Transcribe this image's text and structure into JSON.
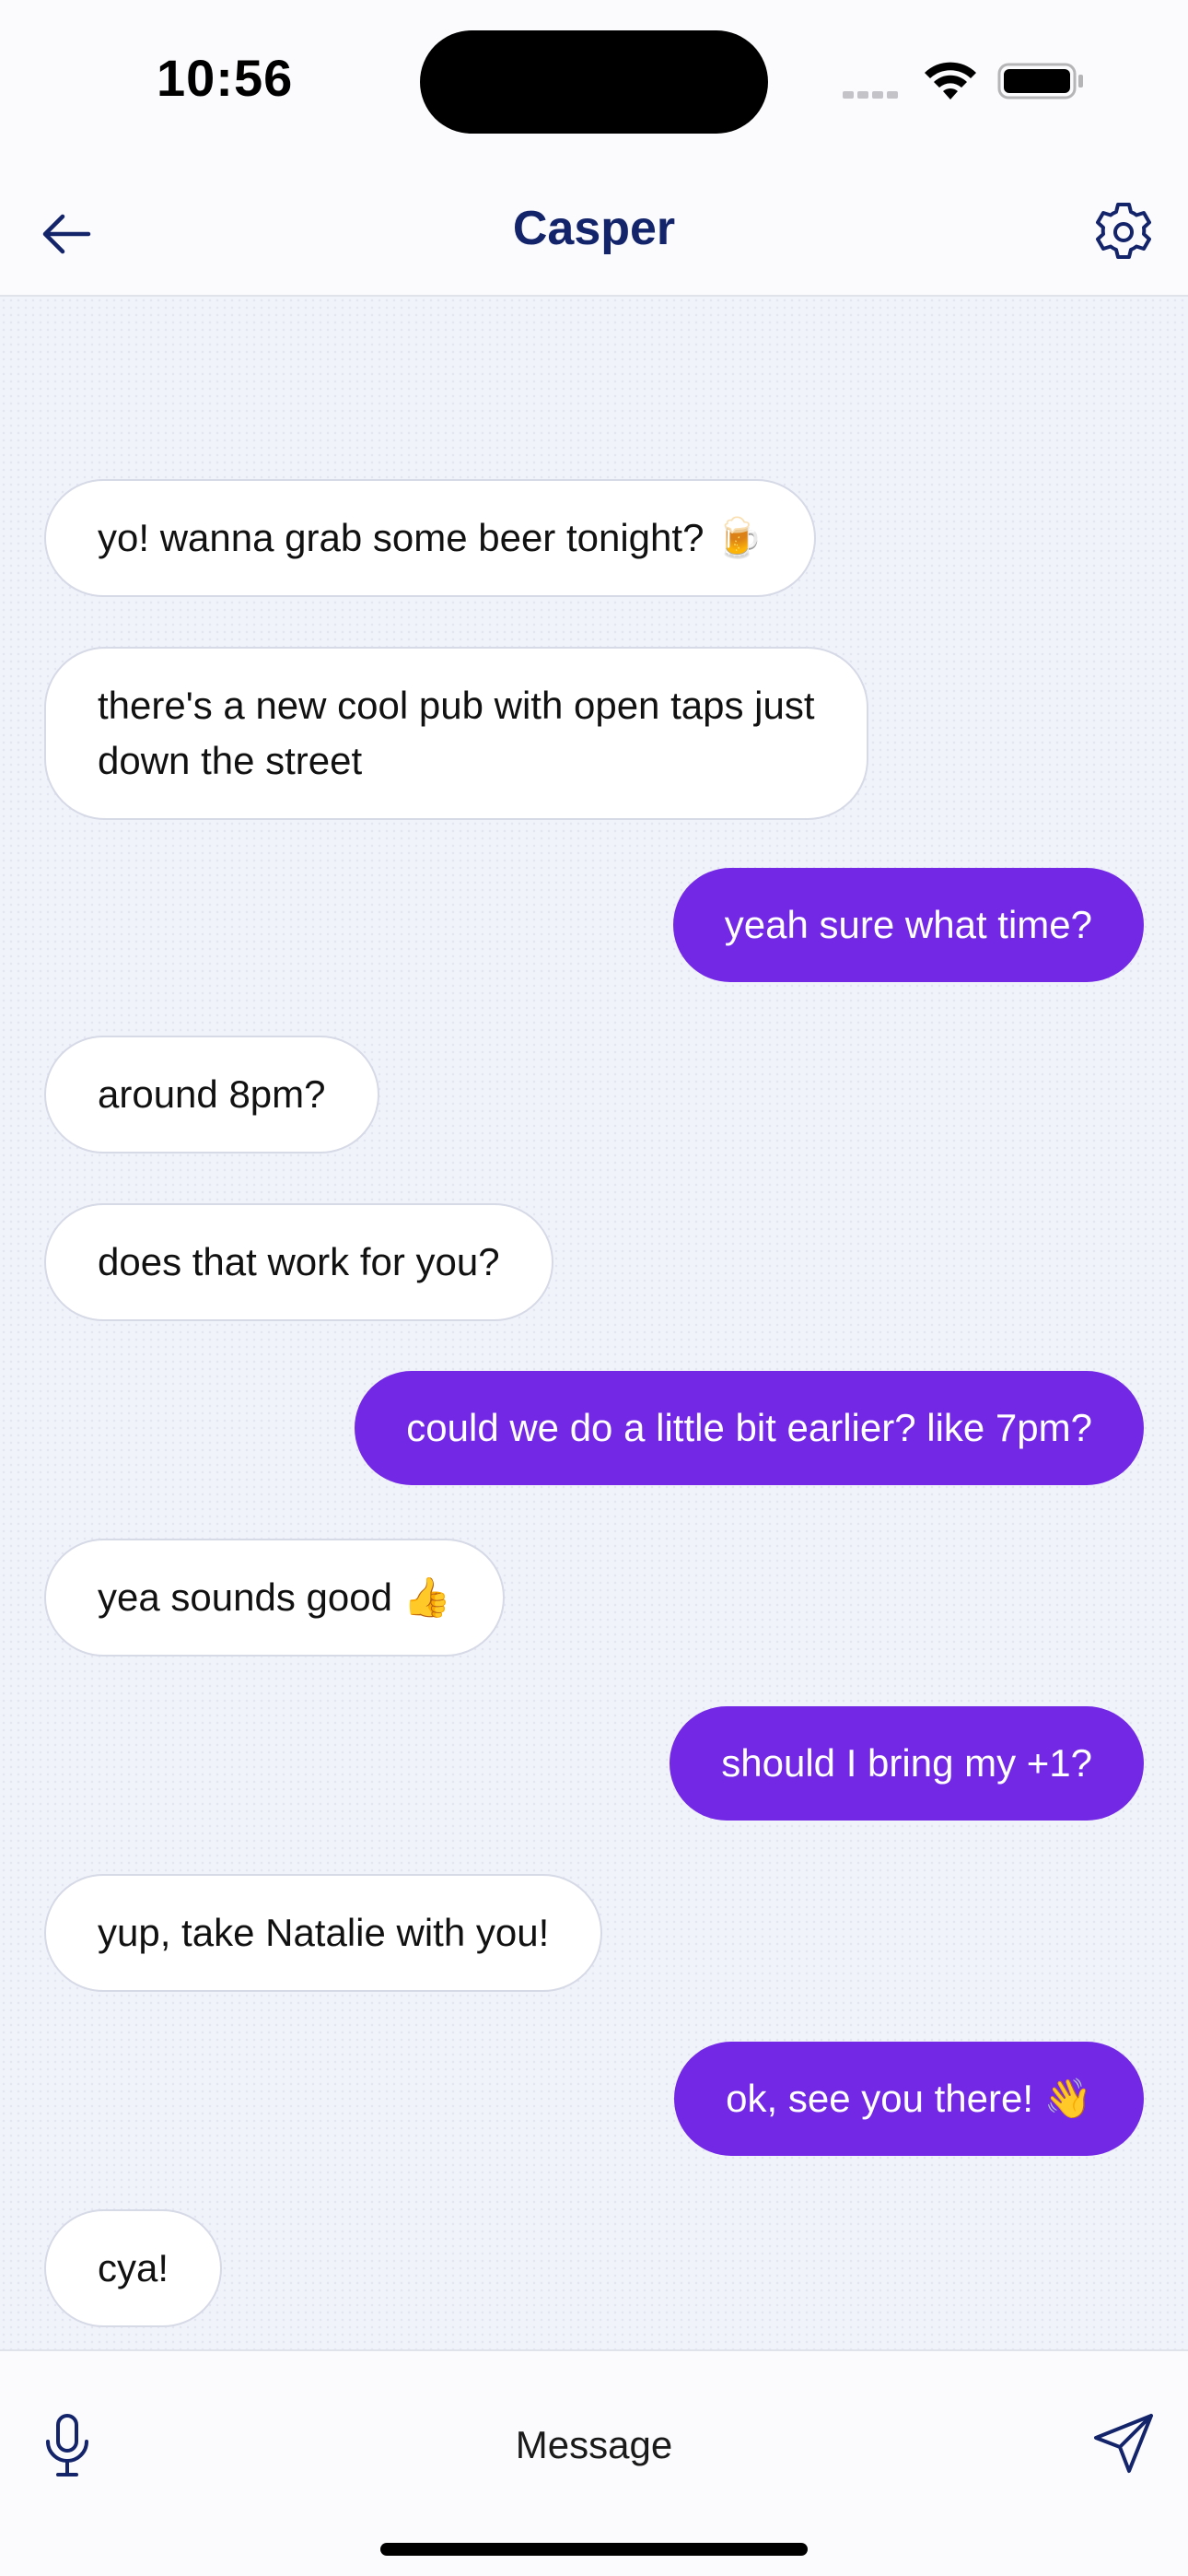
{
  "status_bar": {
    "time": "10:56"
  },
  "header": {
    "title": "Casper"
  },
  "messages": [
    {
      "text": "yo! wanna grab some beer tonight? 🍺",
      "direction": "incoming"
    },
    {
      "text": "there's a new cool pub with open taps just\ndown the street",
      "direction": "incoming"
    },
    {
      "text": "yeah sure what time?",
      "direction": "outgoing"
    },
    {
      "text": "around 8pm?",
      "direction": "incoming"
    },
    {
      "text": "does that work for you?",
      "direction": "incoming"
    },
    {
      "text": "could we do a little bit earlier? like 7pm?",
      "direction": "outgoing"
    },
    {
      "text": "yea sounds good 👍",
      "direction": "incoming"
    },
    {
      "text": "should I bring my +1?",
      "direction": "outgoing"
    },
    {
      "text": "yup, take Natalie with you!",
      "direction": "incoming"
    },
    {
      "text": "ok, see you there! 👋",
      "direction": "outgoing"
    },
    {
      "text": "cya!",
      "direction": "incoming"
    }
  ],
  "composer": {
    "placeholder": "Message"
  },
  "colors": {
    "accent": "#7328e6",
    "title": "#14246b",
    "incoming_bubble": "#ffffff",
    "background": "#f1f3fa"
  },
  "icons": {
    "back": "arrow-left-icon",
    "settings": "gear-icon",
    "mic": "microphone-icon",
    "send": "paper-plane-icon",
    "wifi": "wifi-icon",
    "battery": "battery-icon"
  }
}
